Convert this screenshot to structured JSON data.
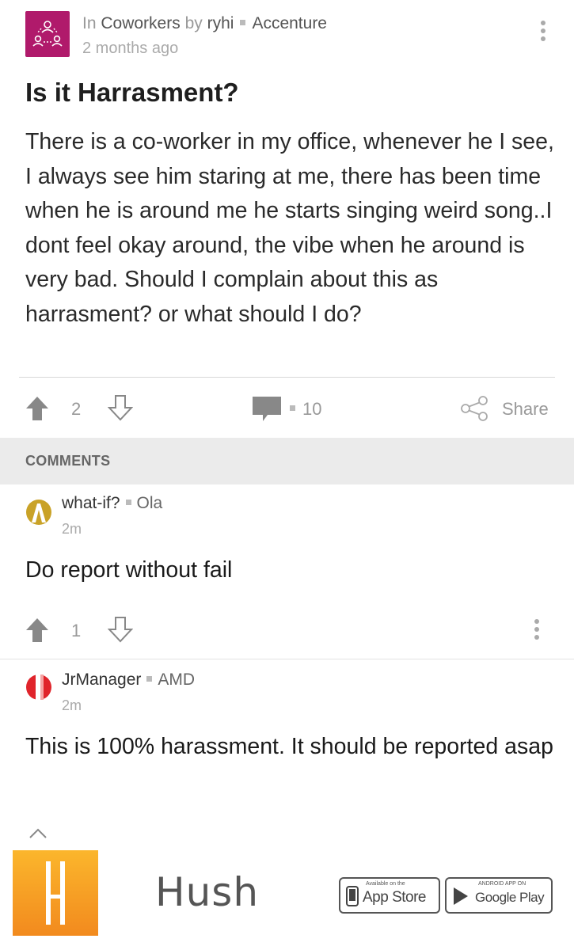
{
  "post": {
    "meta_in": "In",
    "channel": "Coworkers",
    "meta_by": "by",
    "author": "ryhi",
    "company": "Accenture",
    "time": "2 months ago",
    "title": "Is it Harrasment?",
    "body": "There is a co-worker in my office, whenever he I see, I always see him staring at me, there has been time when he is around me he starts singing weird song..I dont feel okay around, the vibe when he around is very bad. Should I complain about this as harrasment? or what should I do?",
    "upvotes": "2",
    "comment_count": "10",
    "share_label": "Share"
  },
  "comments_header": "COMMENTS",
  "comments": [
    {
      "author": "what-if?",
      "company": "Ola",
      "time": "2m",
      "text": "Do report without fail",
      "upvotes": "1"
    },
    {
      "author": "JrManager",
      "company": "AMD",
      "time": "2m",
      "text": "This is 100% harassment. It should be reported asap"
    }
  ],
  "footer": {
    "brand": "Hush",
    "appstore_small": "Available on the",
    "appstore_big": "App Store",
    "googleplay_small": "ANDROID APP ON",
    "googleplay_big": "Google Play"
  },
  "colors": {
    "channel_icon_bg": "#b01a6b",
    "icon_gray": "#999999",
    "logo_gradient": [
      "#fbb62c",
      "#f28a1e"
    ],
    "avatar_jrmanager": "#e0242b",
    "avatar_whatif": "#c9a227"
  },
  "icons": [
    "people-network-icon",
    "more-vertical-icon",
    "upvote-arrow-icon",
    "downvote-arrow-icon",
    "comment-bubble-icon",
    "share-icon",
    "apple-icon",
    "google-play-icon"
  ]
}
